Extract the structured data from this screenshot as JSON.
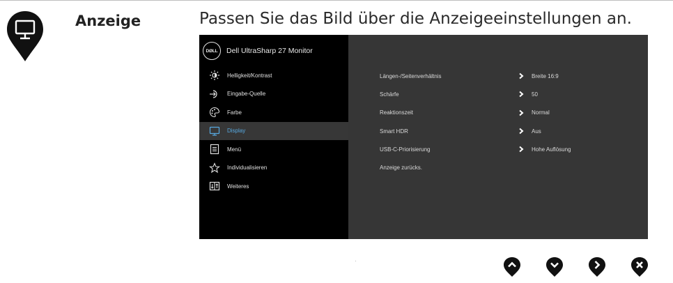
{
  "section": {
    "title": "Anzeige",
    "description": "Passen Sie das Bild über die Anzeigeeinstellungen an.",
    "pin_icon": "monitor-icon"
  },
  "osd": {
    "brand": "DØLL",
    "model": "Dell UltraSharp 27 Monitor",
    "active_item": "Display",
    "accent_color": "#57a9e0",
    "menu": [
      {
        "label": "Helligkeit/Kontrast",
        "icon": "brightness-icon"
      },
      {
        "label": "Eingabe-Quelle",
        "icon": "input-source-icon"
      },
      {
        "label": "Farbe",
        "icon": "color-palette-icon"
      },
      {
        "label": "Display",
        "icon": "display-icon"
      },
      {
        "label": "Menü",
        "icon": "menu-icon"
      },
      {
        "label": "Individualisieren",
        "icon": "star-icon"
      },
      {
        "label": "Weiteres",
        "icon": "others-icon"
      }
    ],
    "settings": [
      {
        "label": "Längen-/Seitenverhältnis",
        "value": "Breite 16:9"
      },
      {
        "label": "Schärfe",
        "value": "50"
      },
      {
        "label": "Reaktionszeit",
        "value": "Normal"
      },
      {
        "label": "Smart HDR",
        "value": "Aus"
      },
      {
        "label": "USB-C-Priorisierung",
        "value": "Hohe Auflösung"
      },
      {
        "label": "Anzeige zurücks.",
        "value": ""
      }
    ]
  },
  "nav_buttons": [
    {
      "name": "up-button",
      "icon": "chevron-up-icon"
    },
    {
      "name": "down-button",
      "icon": "chevron-down-icon"
    },
    {
      "name": "right-button",
      "icon": "chevron-right-icon"
    },
    {
      "name": "close-button",
      "icon": "close-icon"
    }
  ]
}
